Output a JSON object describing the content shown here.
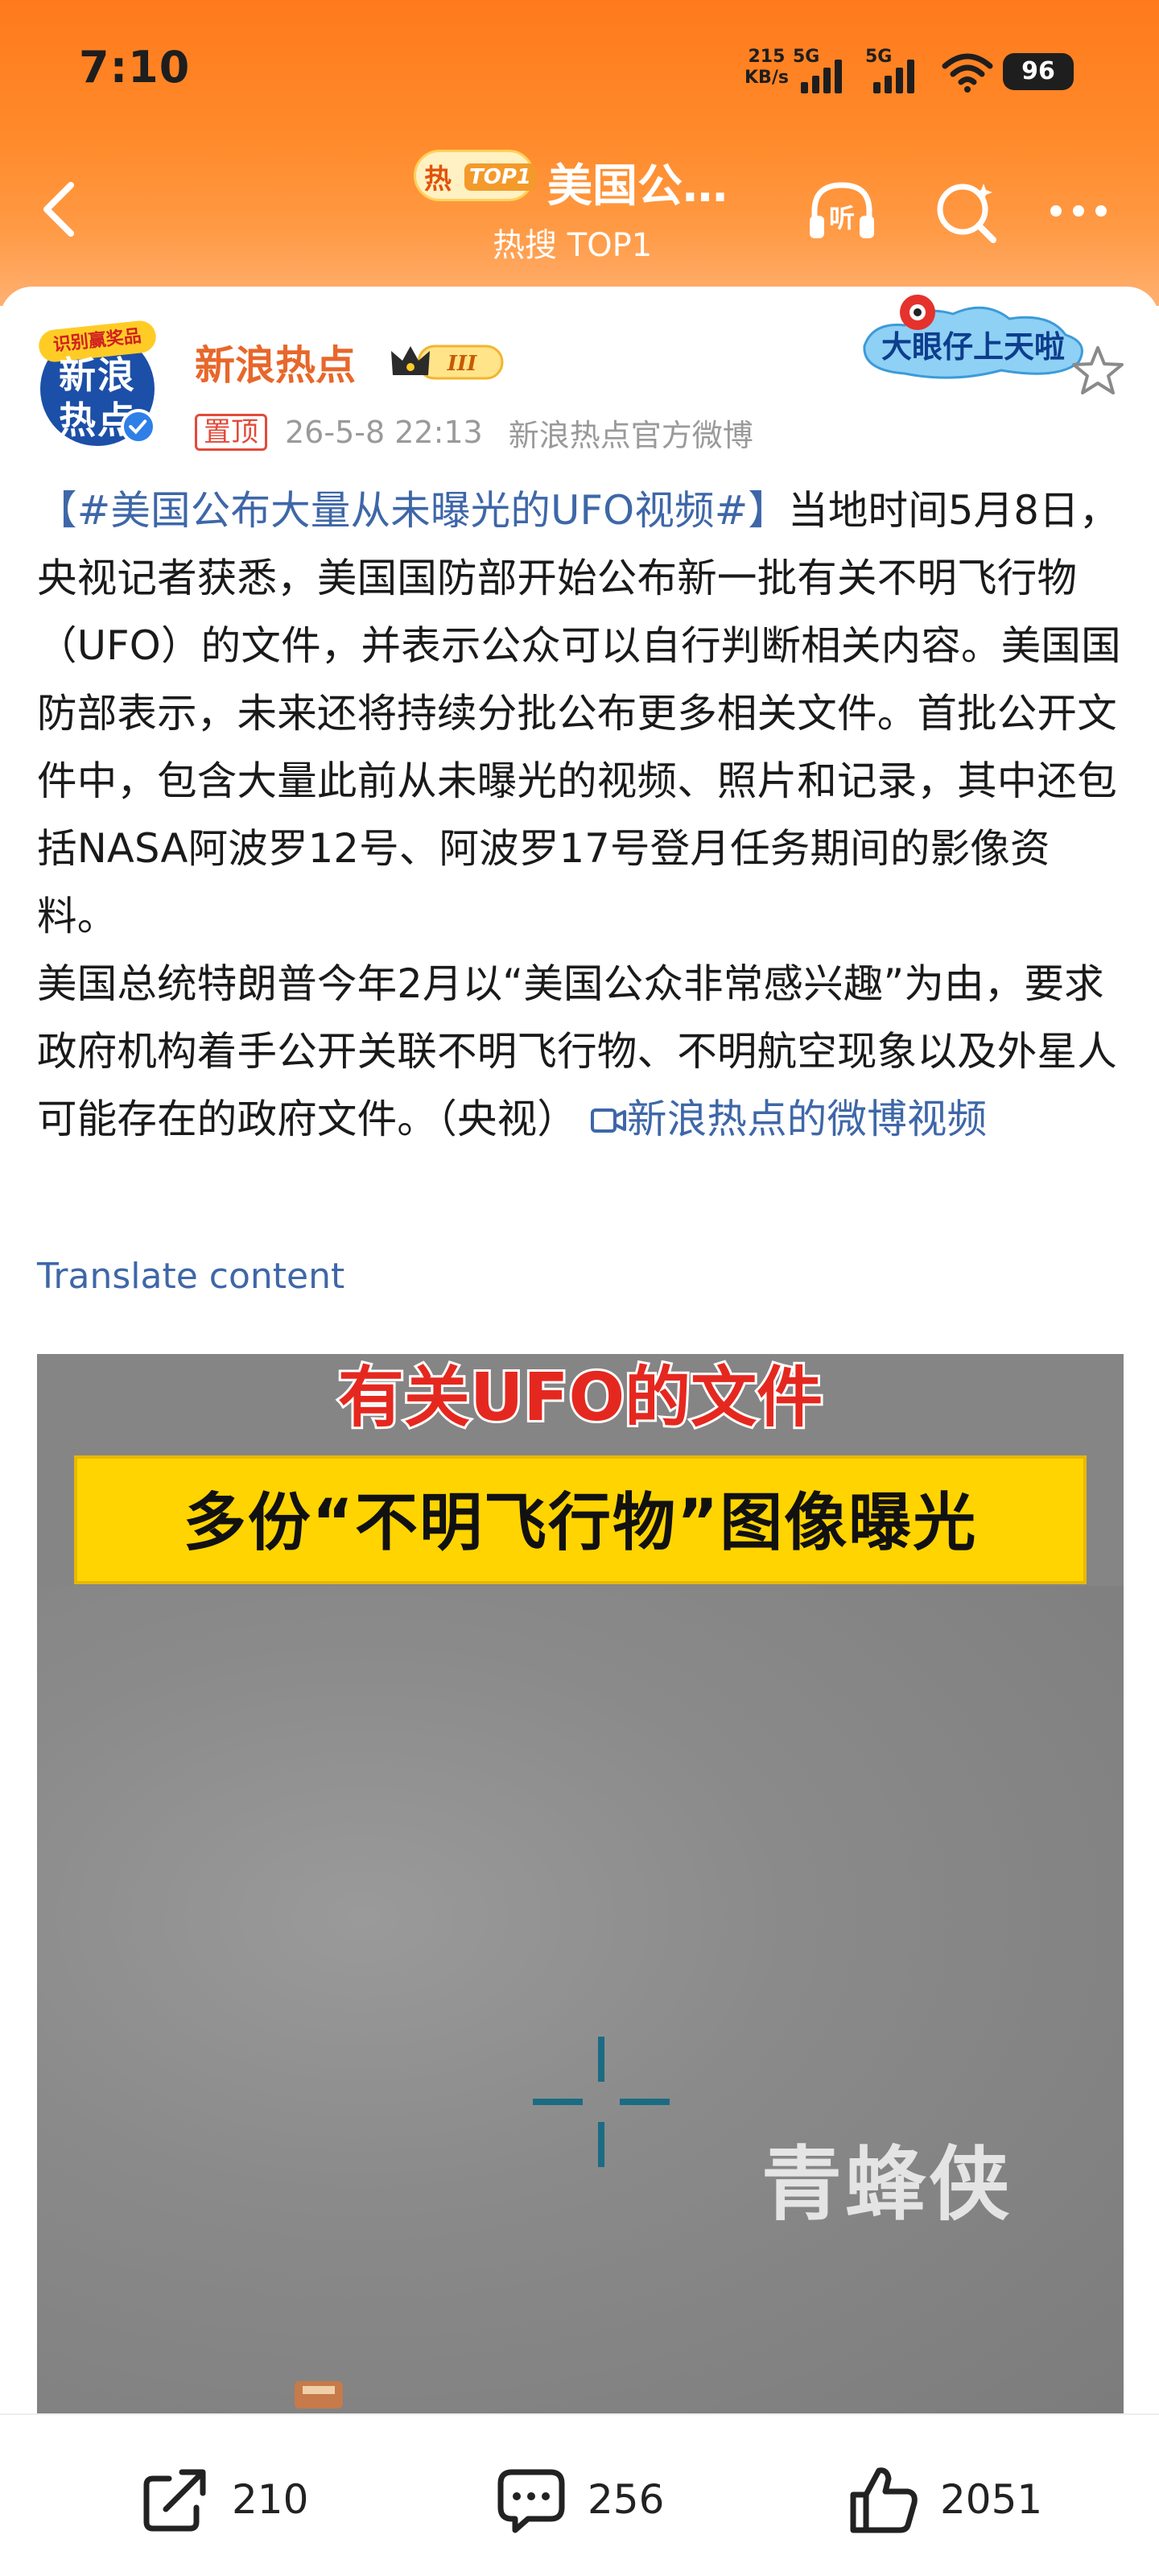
{
  "status_bar": {
    "time": "7:10",
    "net_speed": "215",
    "net_unit": "KB/s",
    "sim1": "5G",
    "sim2": "5G",
    "battery": "96"
  },
  "header": {
    "hot_char": "热",
    "hot_top": "TOP1",
    "title": "美国公…",
    "subtitle": "热搜 TOP1",
    "listen_icon_label": "听"
  },
  "post": {
    "avatar_ring": "识别赢奖品",
    "avatar_text": "新浪热点",
    "author": "新浪热点",
    "vip_level": "III",
    "pin_label": "置顶",
    "timestamp": "26-5-8 22:13",
    "source": "新浪热点官方微博",
    "banner_text": "大眼仔上天啦",
    "hashtag": "【#美国公布大量从未曝光的UFO视频#】",
    "paragraph1": "当地时间5月8日，央视记者获悉，美国国防部开始公布新一批有关不明飞行物（UFO）的文件，并表示公众可以自行判断相关内容。美国国防部表示，未来还将持续分批公布更多相关文件。首批公开文件中，包含大量此前从未曝光的视频、照片和记录，其中还包括NASA阿波罗12号、阿波罗17号登月任务期间的影像资料。",
    "paragraph2": "美国总统特朗普今年2月以“美国公众非常感兴趣”为由，要求政府机构着手公开关联不明飞行物、不明航空现象以及外星人可能存在的政府文件。（央视）",
    "video_link": "新浪热点的微博视频",
    "translate": "Translate content"
  },
  "video": {
    "title": "有关UFO的文件",
    "banner": "多份“不明飞行物”图像曝光",
    "watermark": "青蜂侠"
  },
  "actions": {
    "share_count": "210",
    "comment_count": "256",
    "like_count": "2051"
  }
}
